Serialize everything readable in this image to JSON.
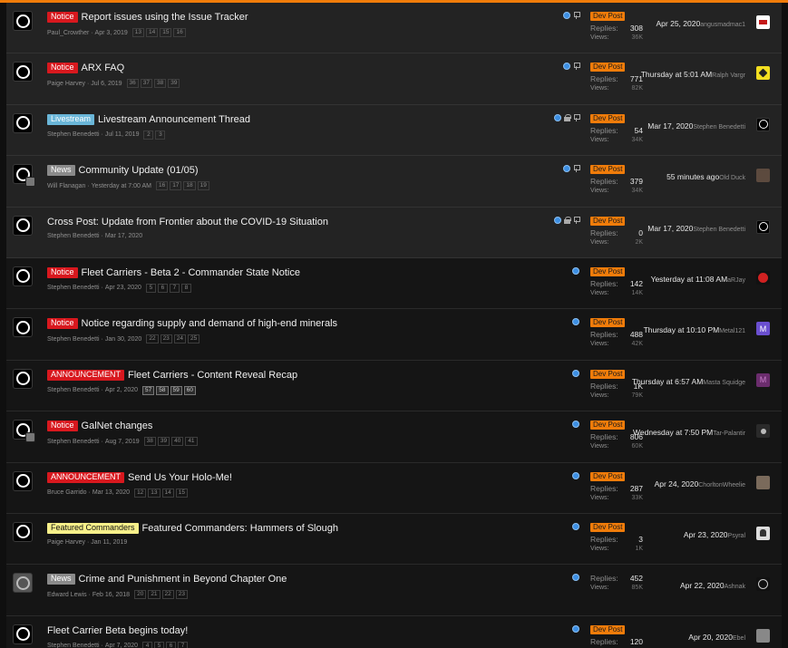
{
  "labels_text": {
    "dev_post": "Dev Post",
    "replies": "Replies:",
    "views": "Views:"
  },
  "colors": {
    "accent": "#f07c0a",
    "notice": "#d8181e",
    "livestream": "#6ab6d8",
    "news": "#8a8a8a",
    "featured": "#f7f08a"
  },
  "threads": [
    {
      "sticky": true,
      "label": "Notice",
      "label_kind": "notice",
      "title": "Report issues using the Issue Tracker",
      "author": "Paul_Crowther",
      "date": "Apr 3, 2019",
      "pages": [
        "13",
        "14",
        "15",
        "16"
      ],
      "icons": [
        "watched-icon",
        "pin-icon"
      ],
      "dev_post": true,
      "replies": "308",
      "views": "36K",
      "last_date": "Apr 25, 2020",
      "last_user": "angusmadmac1",
      "last_avatar": "redflag"
    },
    {
      "sticky": true,
      "label": "Notice",
      "label_kind": "notice",
      "title": "ARX FAQ",
      "author": "Paige Harvey",
      "date": "Jul 6, 2019",
      "pages": [
        "36",
        "37",
        "38",
        "39"
      ],
      "icons": [
        "watched-icon",
        "pin-icon"
      ],
      "dev_post": true,
      "replies": "771",
      "views": "82K",
      "last_date": "Thursday at 5:01 AM",
      "last_user": "Ralph Vargr",
      "last_avatar": "yellow"
    },
    {
      "sticky": true,
      "label": "Livestream",
      "label_kind": "live",
      "title": "Livestream Announcement Thread",
      "author": "Stephen Benedetti",
      "date": "Jul 11, 2019",
      "pages": [
        "2",
        "3"
      ],
      "icons": [
        "watched-icon",
        "lock-icon",
        "pin-icon"
      ],
      "dev_post": true,
      "replies": "54",
      "views": "34K",
      "last_date": "Mar 17, 2020",
      "last_user": "Stephen Benedetti",
      "last_avatar": "ring-av"
    },
    {
      "sticky": true,
      "label": "News",
      "label_kind": "news",
      "title": "Community Update (01/05)",
      "author": "Will Flanagan",
      "date": "Yesterday at 7:00 AM",
      "pages": [
        "16",
        "17",
        "18",
        "19"
      ],
      "icons": [
        "watched-icon",
        "pin-icon"
      ],
      "dev_post": true,
      "replies": "379",
      "views": "34K",
      "last_date": "55 minutes ago",
      "last_user": "Old Duck",
      "last_avatar": "photo1",
      "sub_avatar": true
    },
    {
      "sticky": true,
      "label": "",
      "label_kind": "",
      "title": "Cross Post: Update from Frontier about the COVID-19 Situation",
      "author": "Stephen Benedetti",
      "date": "Mar 17, 2020",
      "pages": [],
      "icons": [
        "watched-icon",
        "lock-icon",
        "pin-icon"
      ],
      "dev_post": true,
      "replies": "0",
      "views": "2K",
      "last_date": "Mar 17, 2020",
      "last_user": "Stephen Benedetti",
      "last_avatar": "ring-av"
    },
    {
      "sticky": false,
      "label": "Notice",
      "label_kind": "notice",
      "title": "Fleet Carriers - Beta 2 - Commander State Notice",
      "author": "Stephen Benedetti",
      "date": "Apr 23, 2020",
      "pages": [
        "5",
        "6",
        "7",
        "8"
      ],
      "icons": [
        "watched-icon"
      ],
      "dev_post": true,
      "replies": "142",
      "views": "14K",
      "last_date": "Yesterday at 11:08 AM",
      "last_user": "aRJay",
      "last_avatar": "redball"
    },
    {
      "sticky": false,
      "label": "Notice",
      "label_kind": "notice",
      "title": "Notice regarding supply and demand of high-end minerals",
      "author": "Stephen Benedetti",
      "date": "Jan 30, 2020",
      "pages": [
        "22",
        "23",
        "24",
        "25"
      ],
      "icons": [
        "watched-icon"
      ],
      "dev_post": true,
      "replies": "488",
      "views": "42K",
      "last_date": "Thursday at 10:10 PM",
      "last_user": "Metal121",
      "last_avatar": "letter-m1",
      "last_avatar_letter": "M"
    },
    {
      "sticky": false,
      "label": "ANNOUNCEMENT",
      "label_kind": "ann",
      "title": "Fleet Carriers - Content Reveal Recap",
      "author": "Stephen Benedetti",
      "date": "Apr 2, 2020",
      "pages": [
        "57",
        "58",
        "59",
        "60"
      ],
      "pages_hl": true,
      "icons": [
        "watched-icon"
      ],
      "dev_post": true,
      "replies": "1K",
      "views": "79K",
      "last_date": "Thursday at 6:57 AM",
      "last_user": "Masta Squidge",
      "last_avatar": "letter-m2",
      "last_avatar_letter": "M"
    },
    {
      "sticky": false,
      "label": "Notice",
      "label_kind": "notice",
      "title": "GalNet changes",
      "author": "Stephen Benedetti",
      "date": "Aug 7, 2019",
      "pages": [
        "38",
        "39",
        "40",
        "41"
      ],
      "icons": [
        "watched-icon"
      ],
      "dev_post": true,
      "replies": "806",
      "views": "60K",
      "last_date": "Wednesday at 7:50 PM",
      "last_user": "Tar-Palantir",
      "last_avatar": "photo2",
      "sub_avatar": true
    },
    {
      "sticky": false,
      "label": "ANNOUNCEMENT",
      "label_kind": "ann",
      "title": "Send Us Your Holo-Me!",
      "author": "Bruce Garrido",
      "date": "Mar 13, 2020",
      "pages": [
        "12",
        "13",
        "14",
        "15"
      ],
      "icons": [
        "watched-icon"
      ],
      "dev_post": true,
      "replies": "287",
      "views": "33K",
      "last_date": "Apr 24, 2020",
      "last_user": "ChorltonWheelie",
      "last_avatar": "photo3"
    },
    {
      "sticky": false,
      "label": "Featured Commanders",
      "label_kind": "feat",
      "title": "Featured Commanders: Hammers of Slough",
      "author": "Paige Harvey",
      "date": "Jan 11, 2019",
      "pages": [],
      "icons": [
        "watched-icon"
      ],
      "dev_post": true,
      "replies": "3",
      "views": "1K",
      "last_date": "Apr 23, 2020",
      "last_user": "Psyral",
      "last_avatar": "skull"
    },
    {
      "sticky": false,
      "label": "News",
      "label_kind": "news",
      "title": "Crime and Punishment in Beyond Chapter One",
      "author": "Edward Lewis",
      "date": "Feb 16, 2018",
      "pages": [
        "20",
        "21",
        "22",
        "23"
      ],
      "icons": [
        "watched-icon"
      ],
      "dev_post": false,
      "replies": "452",
      "views": "85K",
      "last_date": "Apr 22, 2020",
      "last_user": "Ashnak",
      "last_avatar": "circle-o",
      "grey_avatar": true
    },
    {
      "sticky": false,
      "label": "",
      "label_kind": "",
      "title": "Fleet Carrier Beta begins today!",
      "author": "Stephen Benedetti",
      "date": "Apr 7, 2020",
      "pages": [
        "4",
        "5",
        "6",
        "7"
      ],
      "icons": [
        "watched-icon"
      ],
      "dev_post": true,
      "replies": "120",
      "views": "",
      "last_date": "Apr 20, 2020",
      "last_user": "Ebel",
      "last_avatar": "grid"
    }
  ]
}
